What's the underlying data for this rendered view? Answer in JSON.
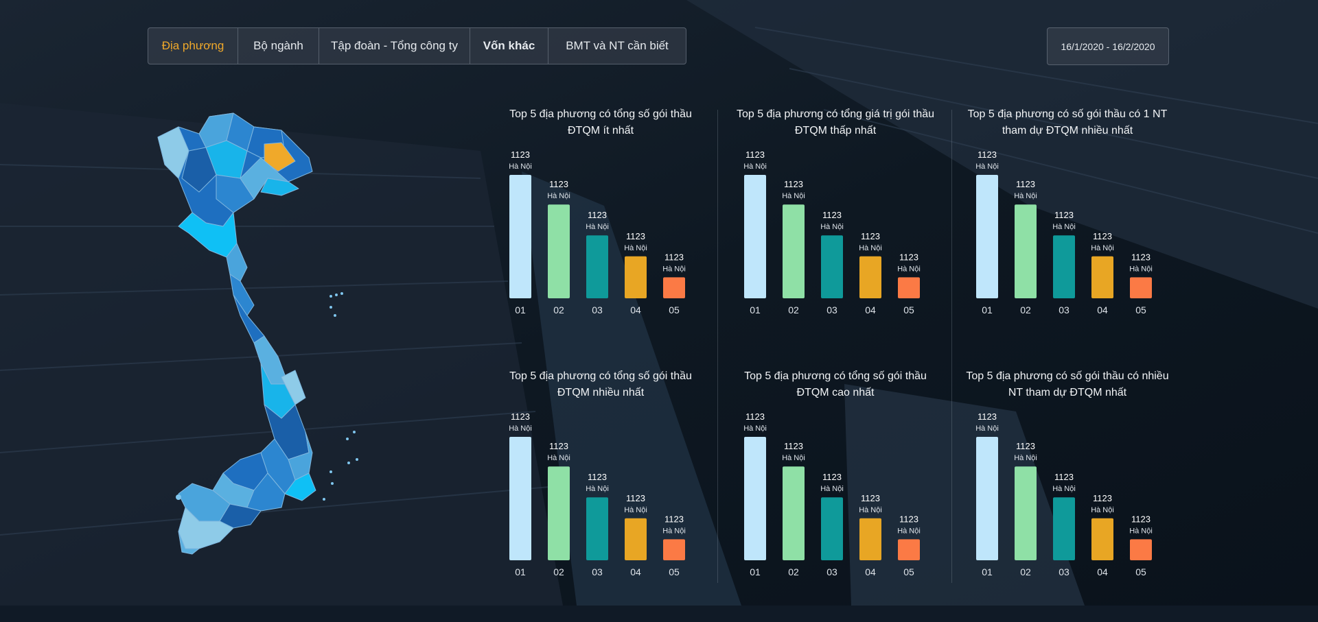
{
  "tabs": [
    {
      "label": "Địa phương",
      "active": true,
      "bold": false
    },
    {
      "label": "Bộ ngành",
      "active": false,
      "bold": false
    },
    {
      "label": "Tập đoàn - Tổng công ty",
      "active": false,
      "bold": false
    },
    {
      "label": "Vốn khác",
      "active": false,
      "bold": true
    },
    {
      "label": "BMT và NT cần biết",
      "active": false,
      "bold": false
    }
  ],
  "date_range": "16/1/2020 - 16/2/2020",
  "colors": {
    "accent": "#f0a92a",
    "bar_colors": [
      "#bfe6fb",
      "#8fe0a6",
      "#0f9a9a",
      "#e8a624",
      "#fb7a45"
    ],
    "map_highlight": "#f0a92a"
  },
  "chart_data": [
    {
      "type": "bar",
      "title": "Top 5 địa phương có tổng số gói thầu ĐTQM ít nhất",
      "categories": [
        "01",
        "02",
        "03",
        "04",
        "05"
      ],
      "values": [
        1123,
        1123,
        1123,
        1123,
        1123
      ],
      "bar_labels": [
        "Hà Nội",
        "Hà Nội",
        "Hà Nội",
        "Hà Nội",
        "Hà Nội"
      ],
      "relative_heights": [
        1.0,
        0.76,
        0.51,
        0.34,
        0.17
      ]
    },
    {
      "type": "bar",
      "title": "Top 5 địa phương có tổng giá trị gói thầu ĐTQM thấp nhất",
      "categories": [
        "01",
        "02",
        "03",
        "04",
        "05"
      ],
      "values": [
        1123,
        1123,
        1123,
        1123,
        1123
      ],
      "bar_labels": [
        "Hà Nội",
        "Hà Nội",
        "Hà Nội",
        "Hà Nội",
        "Hà Nội"
      ],
      "relative_heights": [
        1.0,
        0.76,
        0.51,
        0.34,
        0.17
      ]
    },
    {
      "type": "bar",
      "title": "Top 5 địa phương có số gói thầu có 1 NT tham dự ĐTQM nhiều nhất",
      "categories": [
        "01",
        "02",
        "03",
        "04",
        "05"
      ],
      "values": [
        1123,
        1123,
        1123,
        1123,
        1123
      ],
      "bar_labels": [
        "Hà Nội",
        "Hà Nội",
        "Hà Nội",
        "Hà Nội",
        "Hà Nội"
      ],
      "relative_heights": [
        1.0,
        0.76,
        0.51,
        0.34,
        0.17
      ]
    },
    {
      "type": "bar",
      "title": "Top 5 địa phương có tổng số gói thầu ĐTQM nhiều nhất",
      "categories": [
        "01",
        "02",
        "03",
        "04",
        "05"
      ],
      "values": [
        1123,
        1123,
        1123,
        1123,
        1123
      ],
      "bar_labels": [
        "Hà Nội",
        "Hà Nội",
        "Hà Nội",
        "Hà Nội",
        "Hà Nội"
      ],
      "relative_heights": [
        1.0,
        0.76,
        0.51,
        0.34,
        0.17
      ]
    },
    {
      "type": "bar",
      "title": "Top 5 địa phương có tổng số gói thầu ĐTQM cao nhất",
      "categories": [
        "01",
        "02",
        "03",
        "04",
        "05"
      ],
      "values": [
        1123,
        1123,
        1123,
        1123,
        1123
      ],
      "bar_labels": [
        "Hà Nội",
        "Hà Nội",
        "Hà Nội",
        "Hà Nội",
        "Hà Nội"
      ],
      "relative_heights": [
        1.0,
        0.76,
        0.51,
        0.34,
        0.17
      ]
    },
    {
      "type": "bar",
      "title": "Top 5 địa phương có số gói thầu có nhiều NT tham dự ĐTQM nhất",
      "categories": [
        "01",
        "02",
        "03",
        "04",
        "05"
      ],
      "values": [
        1123,
        1123,
        1123,
        1123,
        1123
      ],
      "bar_labels": [
        "Hà Nội",
        "Hà Nội",
        "Hà Nội",
        "Hà Nội",
        "Hà Nội"
      ],
      "relative_heights": [
        1.0,
        0.76,
        0.51,
        0.34,
        0.17
      ]
    }
  ]
}
